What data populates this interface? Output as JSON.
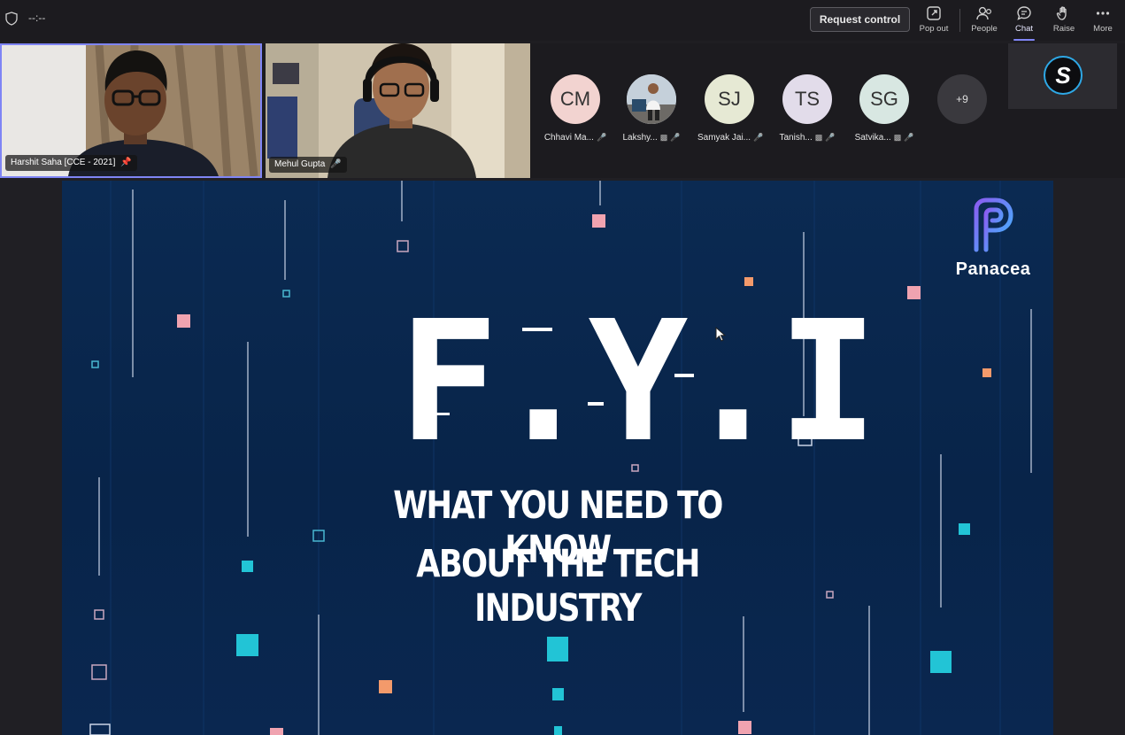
{
  "topbar": {
    "timer": "--:--",
    "request_control_label": "Request control",
    "buttons": [
      {
        "label": "Pop out",
        "icon": "pop-out-icon"
      },
      {
        "label": "People",
        "icon": "people-icon"
      },
      {
        "label": "Chat",
        "icon": "chat-icon"
      },
      {
        "label": "Raise",
        "icon": "raise-hand-icon"
      },
      {
        "label": "More",
        "icon": "more-icon"
      }
    ]
  },
  "videos": [
    {
      "name": "Harshit Saha [CCE - 2021]",
      "status_icon": "pin-icon"
    },
    {
      "name": "Mehul Gupta",
      "status_icon": "mic-off-icon"
    }
  ],
  "participants": [
    {
      "initials": "CM",
      "name": "Chhavi Ma...",
      "color": "#f2d3d0"
    },
    {
      "initials": "",
      "name": "Lakshy...",
      "color": "#cfd9e6"
    },
    {
      "initials": "SJ",
      "name": "Samyak Jai...",
      "color": "#e6e9d4"
    },
    {
      "initials": "TS",
      "name": "Tanish...",
      "color": "#e2dcea"
    },
    {
      "initials": "SG",
      "name": "Satvika...",
      "color": "#d8e7e2"
    }
  ],
  "more_participants": "+9",
  "slide": {
    "brand": "Panacea",
    "title": "F.Y.I",
    "line1": "WHAT YOU NEED TO KNOW",
    "line2": "ABOUT THE TECH INDUSTRY"
  },
  "colors": {
    "accent": "#7f85f5",
    "slide_bg": "#0a2750",
    "square_pink": "#f0a3b0",
    "square_orange": "#f39a6b",
    "square_cyan": "#22c4d6"
  }
}
